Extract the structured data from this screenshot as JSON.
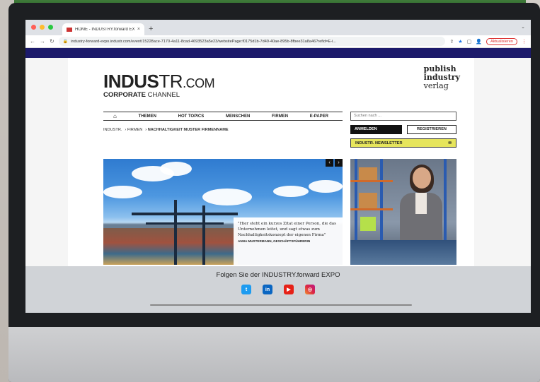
{
  "browser": {
    "tab_title": "HOME - INDUSTRY.forward EX",
    "tab_close": "×",
    "new_tab": "+",
    "url": "industry-forward-expo.industr.com/event/15228ace-7170-4a11-8cad-4693523a5e23/websitePage:f0175d1b-7d49-40ae-895b-8fbee31a8a46?refid=E-i...",
    "update_button": "Aktualisieren"
  },
  "site": {
    "logo_bold": "INDUS",
    "logo_thin": "TR",
    "logo_dotcom": ".COM",
    "logo_sub_bold": "CORPORATE",
    "logo_sub_thin": " CHANNEL",
    "publisher_line1": "publish",
    "publisher_line2": "industry",
    "publisher_line3": "verlag"
  },
  "nav": {
    "items": [
      "THEMEN",
      "HOT TOPICS",
      "MENSCHEN",
      "FIRMEN",
      "E-PAPER"
    ]
  },
  "breadcrumb": {
    "items": [
      "INDUSTR.",
      "› FIRMEN",
      "› NACHHALTIGKEIT MUSTER FIRMENNAME"
    ]
  },
  "sidebar": {
    "search_placeholder": "Suchen nach ...",
    "login_label": "ANMELDEN",
    "register_label": "REGISTRIEREN",
    "newsletter_label": "INDUSTR. NEWSLETTER"
  },
  "hero": {
    "prev": "‹",
    "next": "›",
    "quote": "\"Hier steht ein kurzes Zitat einer Person, die das Unternehmen leitet, und sagt etwas zum Nachhaltigkeitskonzept der eigenen Firma\"",
    "author": "ANNA MUSTERMANN, GESCHÄFTSFÜHRERIN"
  },
  "footer": {
    "follow_text": "Folgen Sie der INDUSTRY.forward EXPO",
    "socials": [
      {
        "name": "twitter",
        "glyph": "t"
      },
      {
        "name": "linkedin",
        "glyph": "in"
      },
      {
        "name": "youtube",
        "glyph": "▶"
      },
      {
        "name": "instagram",
        "glyph": "◎"
      }
    ]
  },
  "colors": {
    "navy_strip": "#1c1a6b",
    "newsletter_bg": "#e6e55c",
    "update_red": "#d33333"
  }
}
